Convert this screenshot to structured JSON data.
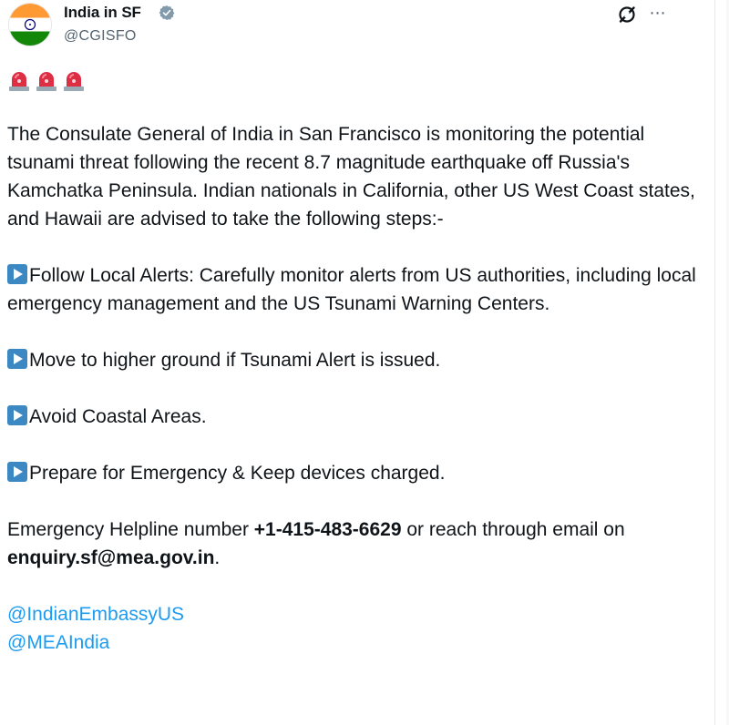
{
  "header": {
    "name": "India in SF",
    "handle": "@CGISFO"
  },
  "sirens": [
    "police-light-emoji",
    "police-light-emoji",
    "police-light-emoji"
  ],
  "post": {
    "intro": "The Consulate General of India in San Francisco is monitoring the potential tsunami threat following the recent 8.7 magnitude earthquake off Russia's Kamchatka Peninsula. Indian nationals in California, other US West Coast states, and Hawaii are advised to take the following steps:-",
    "bullets": [
      "Follow Local Alerts: Carefully monitor alerts from US authorities, including local emergency management and the US Tsunami Warning Centers.",
      "Move to higher ground if Tsunami Alert is issued.",
      "Avoid Coastal Areas.",
      "Prepare for Emergency & Keep devices charged."
    ],
    "helpline_prefix": "Emergency Helpline number ",
    "helpline_number": "+1-415-483-6629",
    "helpline_middle": " or reach through email on ",
    "helpline_email": "enquiry.sf@mea.gov.in",
    "helpline_suffix": ".",
    "mentions": [
      "@IndianEmbassyUS",
      "@MEAIndia"
    ]
  },
  "colors": {
    "mention": "#1d9bf0",
    "verified_badge": "#829aab",
    "bullet_icon": "#3b88c3",
    "siren_red": "#dd2e44"
  }
}
